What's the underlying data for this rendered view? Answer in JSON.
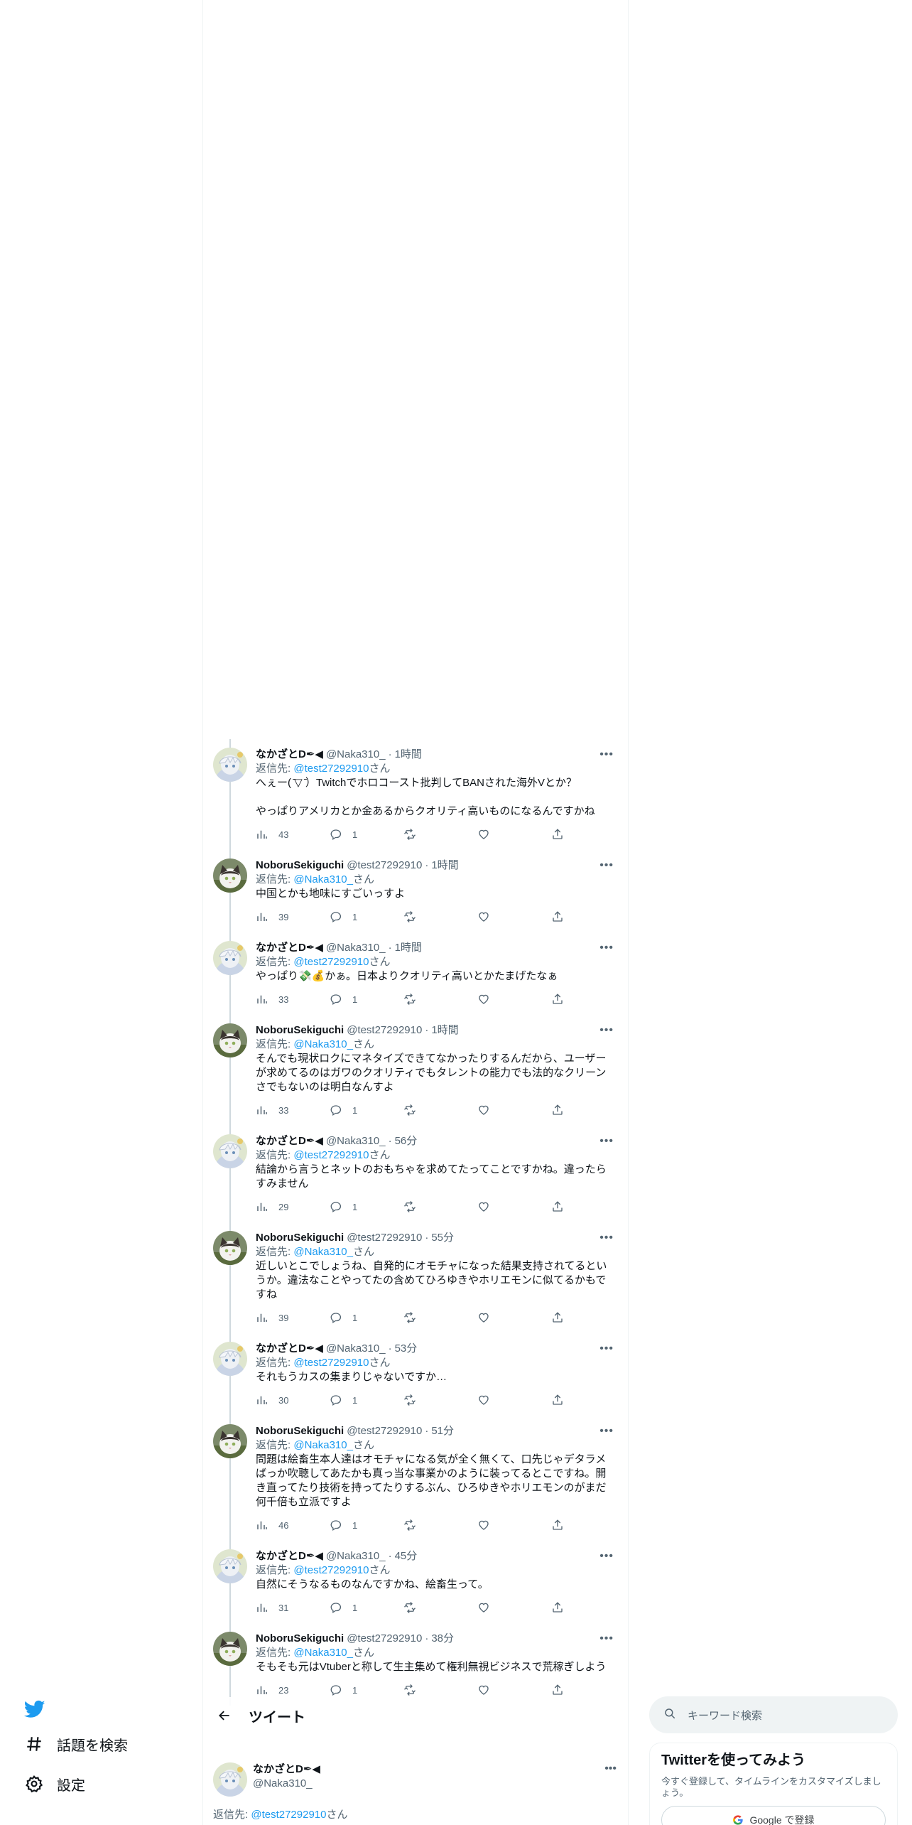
{
  "nav": {
    "explore_label": "話題を検索",
    "settings_label": "設定"
  },
  "header": {
    "title": "ツイート"
  },
  "users": {
    "naka": {
      "name": "なかざとD✒◀",
      "handle": "@Naka310_"
    },
    "noboru": {
      "name": "NoboruSekiguchi",
      "handle": "@test27292910"
    }
  },
  "thread": [
    {
      "user": "naka",
      "time": "1時間",
      "reply_prefix": "返信先: ",
      "reply_to": "@test27292910",
      "reply_suffix": "さん",
      "text": "へぇー( ̄▽ ̄）Twitchでホロコースト批判してBANされた海外Vとか？\n\nやっぱりアメリカとか金あるからクオリティ高いものになるんですかね",
      "views": "43",
      "replies": "1"
    },
    {
      "user": "noboru",
      "time": "1時間",
      "reply_prefix": "返信先: ",
      "reply_to": "@Naka310_",
      "reply_suffix": "さん",
      "text": "中国とかも地味にすごいっすよ",
      "views": "39",
      "replies": "1"
    },
    {
      "user": "naka",
      "time": "1時間",
      "reply_prefix": "返信先: ",
      "reply_to": "@test27292910",
      "reply_suffix": "さん",
      "text": "やっぱり💸💰かぁ。日本よりクオリティ高いとかたまげたなぁ",
      "views": "33",
      "replies": "1"
    },
    {
      "user": "noboru",
      "time": "1時間",
      "reply_prefix": "返信先: ",
      "reply_to": "@Naka310_",
      "reply_suffix": "さん",
      "text": "そんでも現状ロクにマネタイズできてなかったりするんだから、ユーザーが求めてるのはガワのクオリティでもタレントの能力でも法的なクリーンさでもないのは明白なんすよ",
      "views": "33",
      "replies": "1"
    },
    {
      "user": "naka",
      "time": "56分",
      "reply_prefix": "返信先: ",
      "reply_to": "@test27292910",
      "reply_suffix": "さん",
      "text": "結論から言うとネットのおもちゃを求めてたってことですかね。違ったらすみません",
      "views": "29",
      "replies": "1"
    },
    {
      "user": "noboru",
      "time": "55分",
      "reply_prefix": "返信先: ",
      "reply_to": "@Naka310_",
      "reply_suffix": "さん",
      "text": "近しいとこでしょうね、自発的にオモチャになった結果支持されてるというか。違法なことやってたの含めてひろゆきやホリエモンに似てるかもですね",
      "views": "39",
      "replies": "1"
    },
    {
      "user": "naka",
      "time": "53分",
      "reply_prefix": "返信先: ",
      "reply_to": "@test27292910",
      "reply_suffix": "さん",
      "text": "それもうカスの集まりじゃないですか…",
      "views": "30",
      "replies": "1"
    },
    {
      "user": "noboru",
      "time": "51分",
      "reply_prefix": "返信先: ",
      "reply_to": "@Naka310_",
      "reply_suffix": "さん",
      "text": "問題は絵畜生本人達はオモチャになる気が全く無くて、口先じゃデタラメばっか吹聴してあたかも真っ当な事業かのように装ってるとこですね。開き直ってたり技術を持ってたりするぶん、ひろゆきやホリエモンのがまだ何千倍も立派ですよ",
      "views": "46",
      "replies": "1"
    },
    {
      "user": "naka",
      "time": "45分",
      "reply_prefix": "返信先: ",
      "reply_to": "@test27292910",
      "reply_suffix": "さん",
      "text": "自然にそうなるものなんですかね、絵畜生って。",
      "views": "31",
      "replies": "1"
    },
    {
      "user": "noboru",
      "time": "38分",
      "reply_prefix": "返信先: ",
      "reply_to": "@Naka310_",
      "reply_suffix": "さん",
      "text": "そもそも元はVtuberと称して生主集めて権利無視ビジネスで荒稼ぎしよう",
      "views": "23",
      "replies": "1"
    }
  ],
  "main_tweet": {
    "user": "naka",
    "reply_prefix": "返信先: ",
    "reply_to": "@test27292910",
    "reply_suffix": "さん"
  },
  "right": {
    "search_placeholder": "キーワード検索",
    "signup_title": "Twitterを使ってみよう",
    "signup_desc": "今すぐ登録して、タイムラインをカスタマイズしましょう。",
    "google_label": "Google で登録"
  },
  "colors": {
    "accent": "#1d9bf0",
    "muted": "#536471",
    "text": "#0f1419",
    "border": "#eff3f4"
  },
  "icons": [
    "twitter-bird-icon",
    "hashtag-icon",
    "gear-icon",
    "back-arrow-icon",
    "search-icon",
    "views-icon",
    "reply-icon",
    "retweet-icon",
    "like-icon",
    "share-icon",
    "more-icon",
    "google-icon"
  ]
}
